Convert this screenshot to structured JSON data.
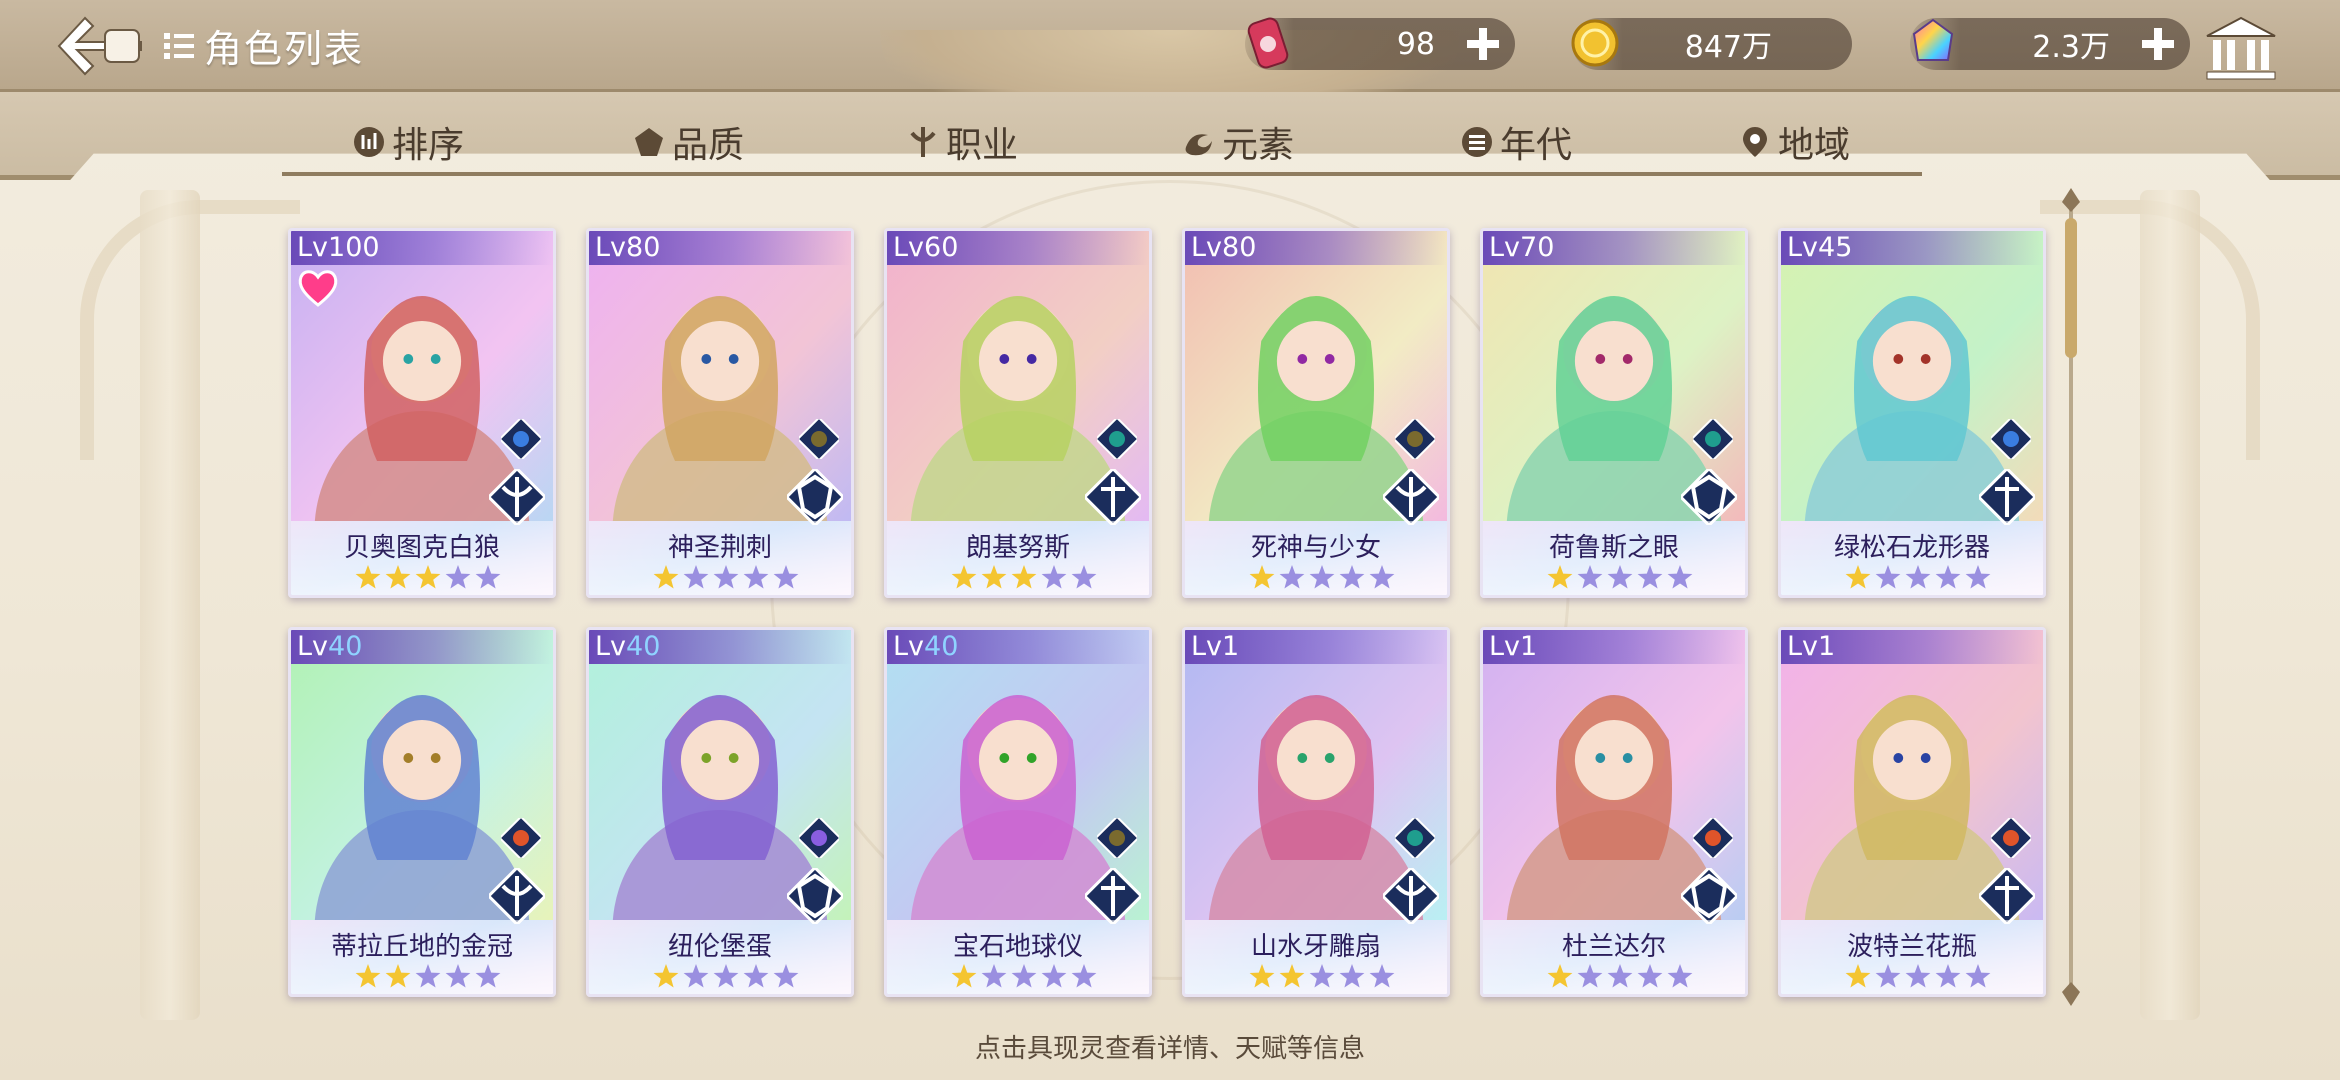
{
  "header": {
    "title": "角色列表",
    "resources": [
      {
        "name": "ticket",
        "value": "98"
      },
      {
        "name": "gold",
        "value": "847万"
      },
      {
        "name": "gem",
        "value": "2.3万"
      }
    ]
  },
  "filters": [
    {
      "label": "排序",
      "icon": "sort-icon"
    },
    {
      "label": "品质",
      "icon": "quality-icon"
    },
    {
      "label": "职业",
      "icon": "class-icon"
    },
    {
      "label": "元素",
      "icon": "element-icon"
    },
    {
      "label": "年代",
      "icon": "era-icon"
    },
    {
      "label": "地域",
      "icon": "region-icon"
    }
  ],
  "cards": [
    {
      "lv_prefix": "Lv",
      "level": "100",
      "name": "贝奥图克白狼",
      "stars": 3,
      "element": "water",
      "favorite": true
    },
    {
      "lv_prefix": "Lv",
      "level": "80",
      "name": "神圣荆刺",
      "stars": 1,
      "element": "earth"
    },
    {
      "lv_prefix": "Lv",
      "level": "60",
      "name": "朗基努斯",
      "stars": 3,
      "element": "wind"
    },
    {
      "lv_prefix": "Lv",
      "level": "80",
      "name": "死神与少女",
      "stars": 1,
      "element": "earth"
    },
    {
      "lv_prefix": "Lv",
      "level": "70",
      "name": "荷鲁斯之眼",
      "stars": 1,
      "element": "wind"
    },
    {
      "lv_prefix": "Lv",
      "level": "45",
      "name": "绿松石龙形器",
      "stars": 1,
      "element": "water"
    },
    {
      "lv_prefix": "Lv",
      "level": "40",
      "name": "蒂拉丘地的金冠",
      "stars": 2,
      "element": "fire"
    },
    {
      "lv_prefix": "Lv",
      "level": "40",
      "name": "纽伦堡蛋",
      "stars": 1,
      "element": "thunder"
    },
    {
      "lv_prefix": "Lv",
      "level": "40",
      "name": "宝石地球仪",
      "stars": 1,
      "element": "earth"
    },
    {
      "lv_prefix": "Lv",
      "level": "1",
      "name": "山水牙雕扇",
      "stars": 2,
      "element": "wind"
    },
    {
      "lv_prefix": "Lv",
      "level": "1",
      "name": "杜兰达尔",
      "stars": 1,
      "element": "fire"
    },
    {
      "lv_prefix": "Lv",
      "level": "1",
      "name": "波特兰花瓶",
      "stars": 1,
      "element": "fire"
    }
  ],
  "footer": {
    "hint": "点击具现灵查看详情、天赋等信息"
  },
  "colors": {
    "accent_purple": "#6a4ab8",
    "star_gold": "#f4c531",
    "star_empty": "#9a8fe0",
    "topbar": "#b9a78c"
  }
}
